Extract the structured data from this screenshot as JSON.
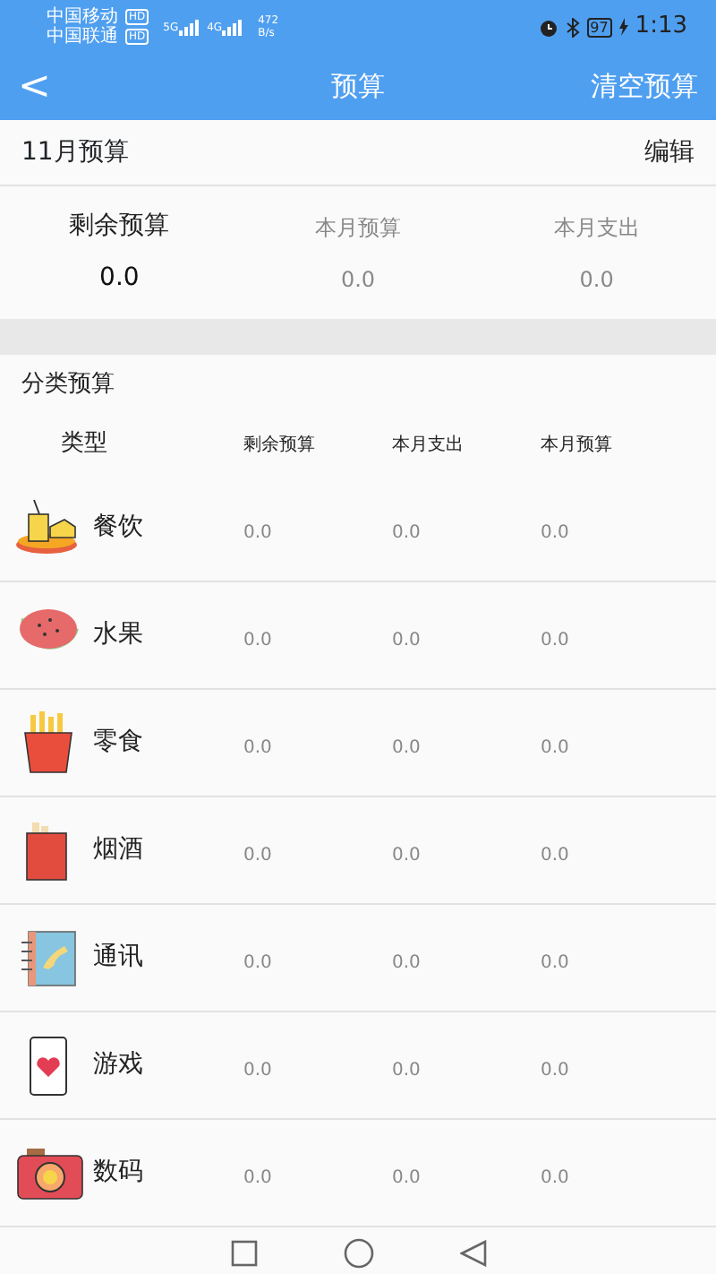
{
  "status_bar": {
    "carriers": [
      {
        "name": "中国移动",
        "badge": "HD"
      },
      {
        "name": "中国联通",
        "badge": "HD"
      }
    ],
    "signals": [
      {
        "label": "5G"
      },
      {
        "label": "4G"
      }
    ],
    "speed": "472",
    "speed_unit": "B/s",
    "battery": "97",
    "time": "1:13"
  },
  "header": {
    "back": "<",
    "title": "预算",
    "action": "清空预算"
  },
  "month": {
    "title": "11月预算",
    "action": "编辑"
  },
  "summary": [
    {
      "label": "剩余预算",
      "value": "0.0",
      "primary": true
    },
    {
      "label": "本月预算",
      "value": "0.0",
      "primary": false
    },
    {
      "label": "本月支出",
      "value": "0.0",
      "primary": false
    }
  ],
  "categories": {
    "title": "分类预算",
    "columns": [
      "类型",
      "剩余预算",
      "本月支出",
      "本月预算"
    ],
    "rows": [
      {
        "cells": [
          "餐饮",
          "0.0",
          "0.0",
          "0.0"
        ]
      },
      {
        "cells": [
          "水果",
          "0.0",
          "0.0",
          "0.0"
        ]
      },
      {
        "cells": [
          "零食",
          "0.0",
          "0.0",
          "0.0"
        ]
      },
      {
        "cells": [
          "烟酒",
          "0.0",
          "0.0",
          "0.0"
        ]
      },
      {
        "cells": [
          "通讯",
          "0.0",
          "0.0",
          "0.0"
        ]
      },
      {
        "cells": [
          "游戏",
          "0.0",
          "0.0",
          "0.0"
        ]
      },
      {
        "cells": [
          "数码",
          "0.0",
          "0.0",
          "0.0"
        ]
      }
    ]
  }
}
